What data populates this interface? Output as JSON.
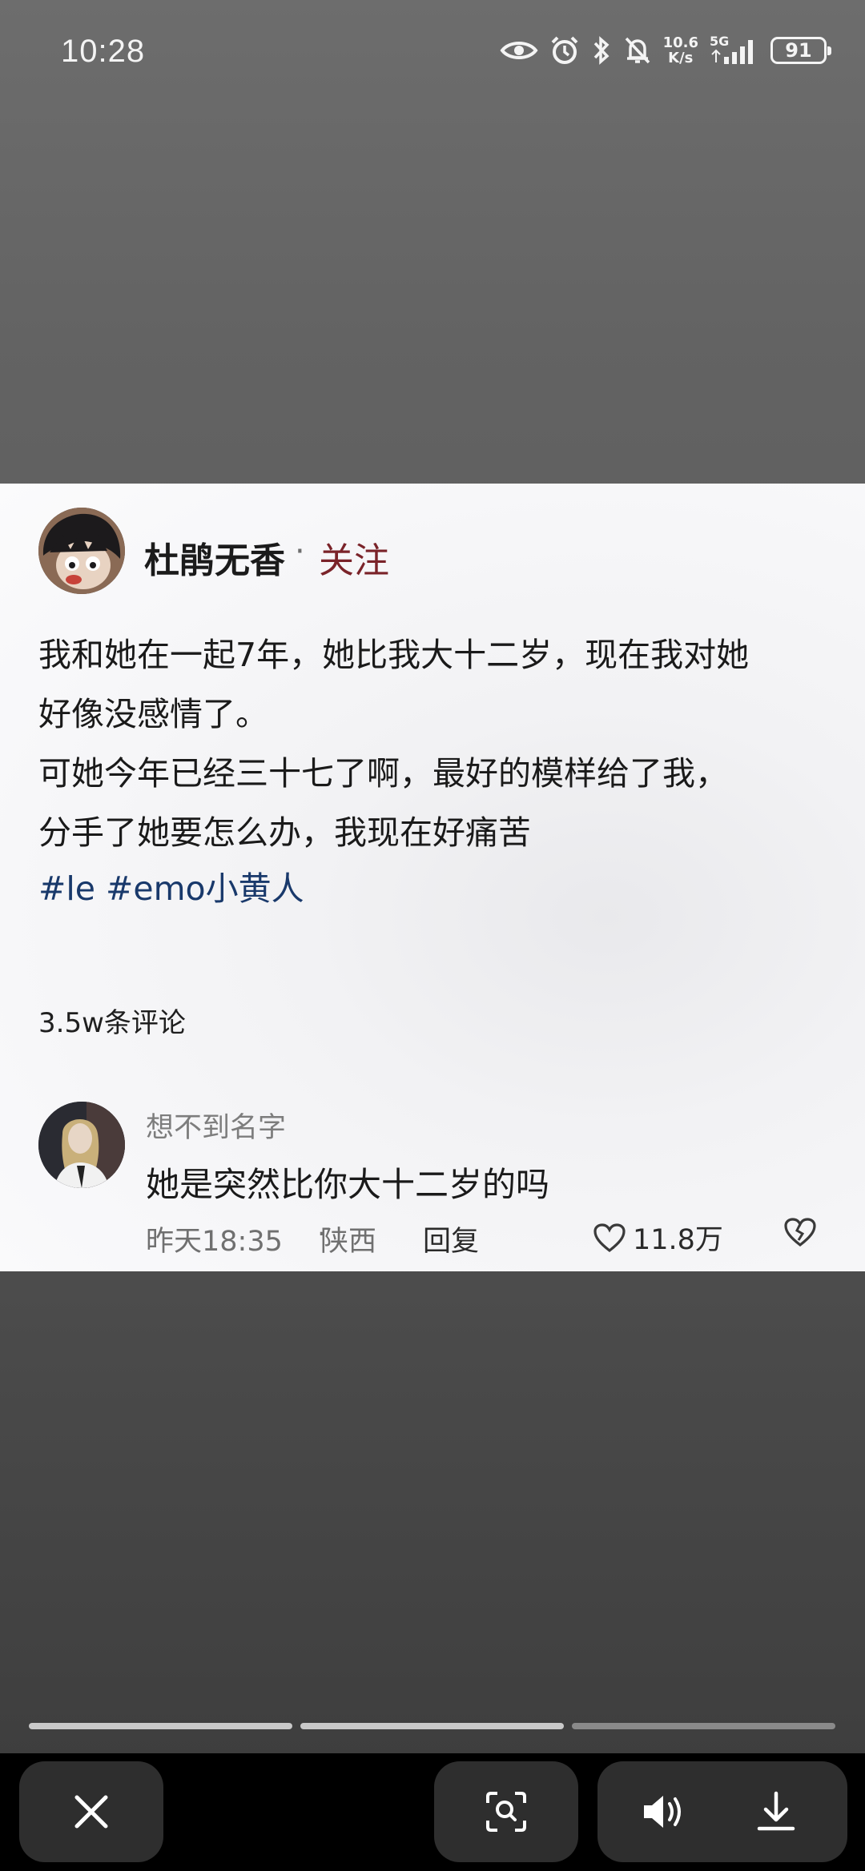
{
  "status_bar": {
    "time": "10:28",
    "net_speed_top": "10.6",
    "net_speed_bottom": "K/s",
    "signal_label": "5G",
    "battery": "91",
    "icons": [
      "eye-icon",
      "alarm-icon",
      "bluetooth-icon",
      "mute-bell-icon",
      "signal-icon"
    ]
  },
  "post": {
    "author": "杜鹃无香",
    "separator": "·",
    "follow_label": "关注",
    "lines": [
      "我和她在一起7年，她比我大十二岁，现在我对她",
      "好像没感情了。",
      "可她今年已经三十七了啊，最好的模样给了我，",
      "分手了她要怎么办，我现在好痛苦"
    ],
    "hashtags": "#le #emo小黄人",
    "comment_count": "3.5w条评论"
  },
  "comment": {
    "username": "想不到名字",
    "text": "她是突然比你大十二岁的吗",
    "time": "昨天18:35",
    "separator": "·",
    "location": "陕西",
    "reply_label": "回复",
    "likes": "11.8万"
  },
  "viewer": {
    "progress_segments": 3,
    "active_color": "#c9c9c9",
    "inactive_color": "#8a8a8a",
    "buttons": [
      "close-icon",
      "lens-search-icon",
      "volume-icon",
      "download-icon"
    ]
  }
}
